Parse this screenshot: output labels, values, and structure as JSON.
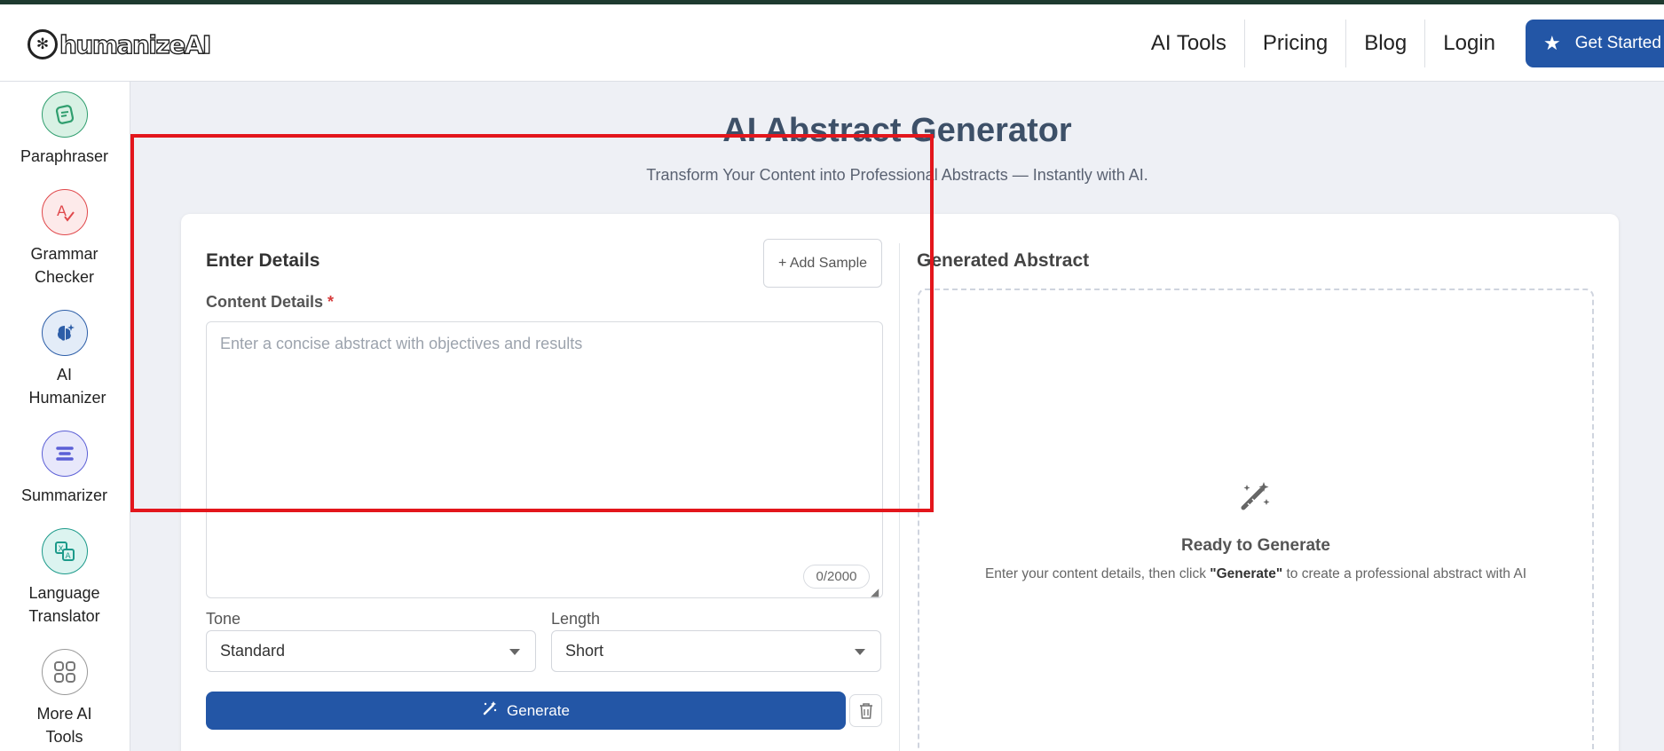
{
  "header": {
    "logo_text": "humanizeAI",
    "nav": [
      "AI Tools",
      "Pricing",
      "Blog",
      "Login"
    ],
    "cta_label": "Get Started"
  },
  "sidebar": {
    "items": [
      {
        "label": "Paraphraser",
        "icon": "paraphraser-icon",
        "color": "#2f9e6e"
      },
      {
        "label": "Grammar Checker",
        "icon": "grammar-icon",
        "color": "#e0484b"
      },
      {
        "label": "AI Humanizer",
        "icon": "brain-icon",
        "color": "#2d5ea8"
      },
      {
        "label": "Summarizer",
        "icon": "summarizer-icon",
        "color": "#5b5fd6"
      },
      {
        "label": "Language Translator",
        "icon": "translate-icon",
        "color": "#1c9a8a"
      },
      {
        "label": "More AI Tools",
        "icon": "grid-icon",
        "color": "#777777"
      }
    ]
  },
  "main": {
    "title": "AI Abstract Generator",
    "subtitle": "Transform Your Content into Professional Abstracts — Instantly with AI."
  },
  "form": {
    "title": "Enter Details",
    "add_sample": "+ Add Sample",
    "content_label": "Content Details",
    "required_mark": "*",
    "placeholder": "Enter a concise abstract with objectives and results",
    "counter": "0/2000",
    "tone_label": "Tone",
    "tone_value": "Standard",
    "length_label": "Length",
    "length_value": "Short",
    "generate_label": "Generate"
  },
  "output": {
    "title": "Generated Abstract",
    "ready_title": "Ready to Generate",
    "ready_text_before": "Enter your content details, then click ",
    "ready_text_bold": "\"Generate\"",
    "ready_text_after": " to create a professional abstract with AI"
  },
  "colors": {
    "brand": "#2356a6",
    "highlight": "#e3161c"
  }
}
